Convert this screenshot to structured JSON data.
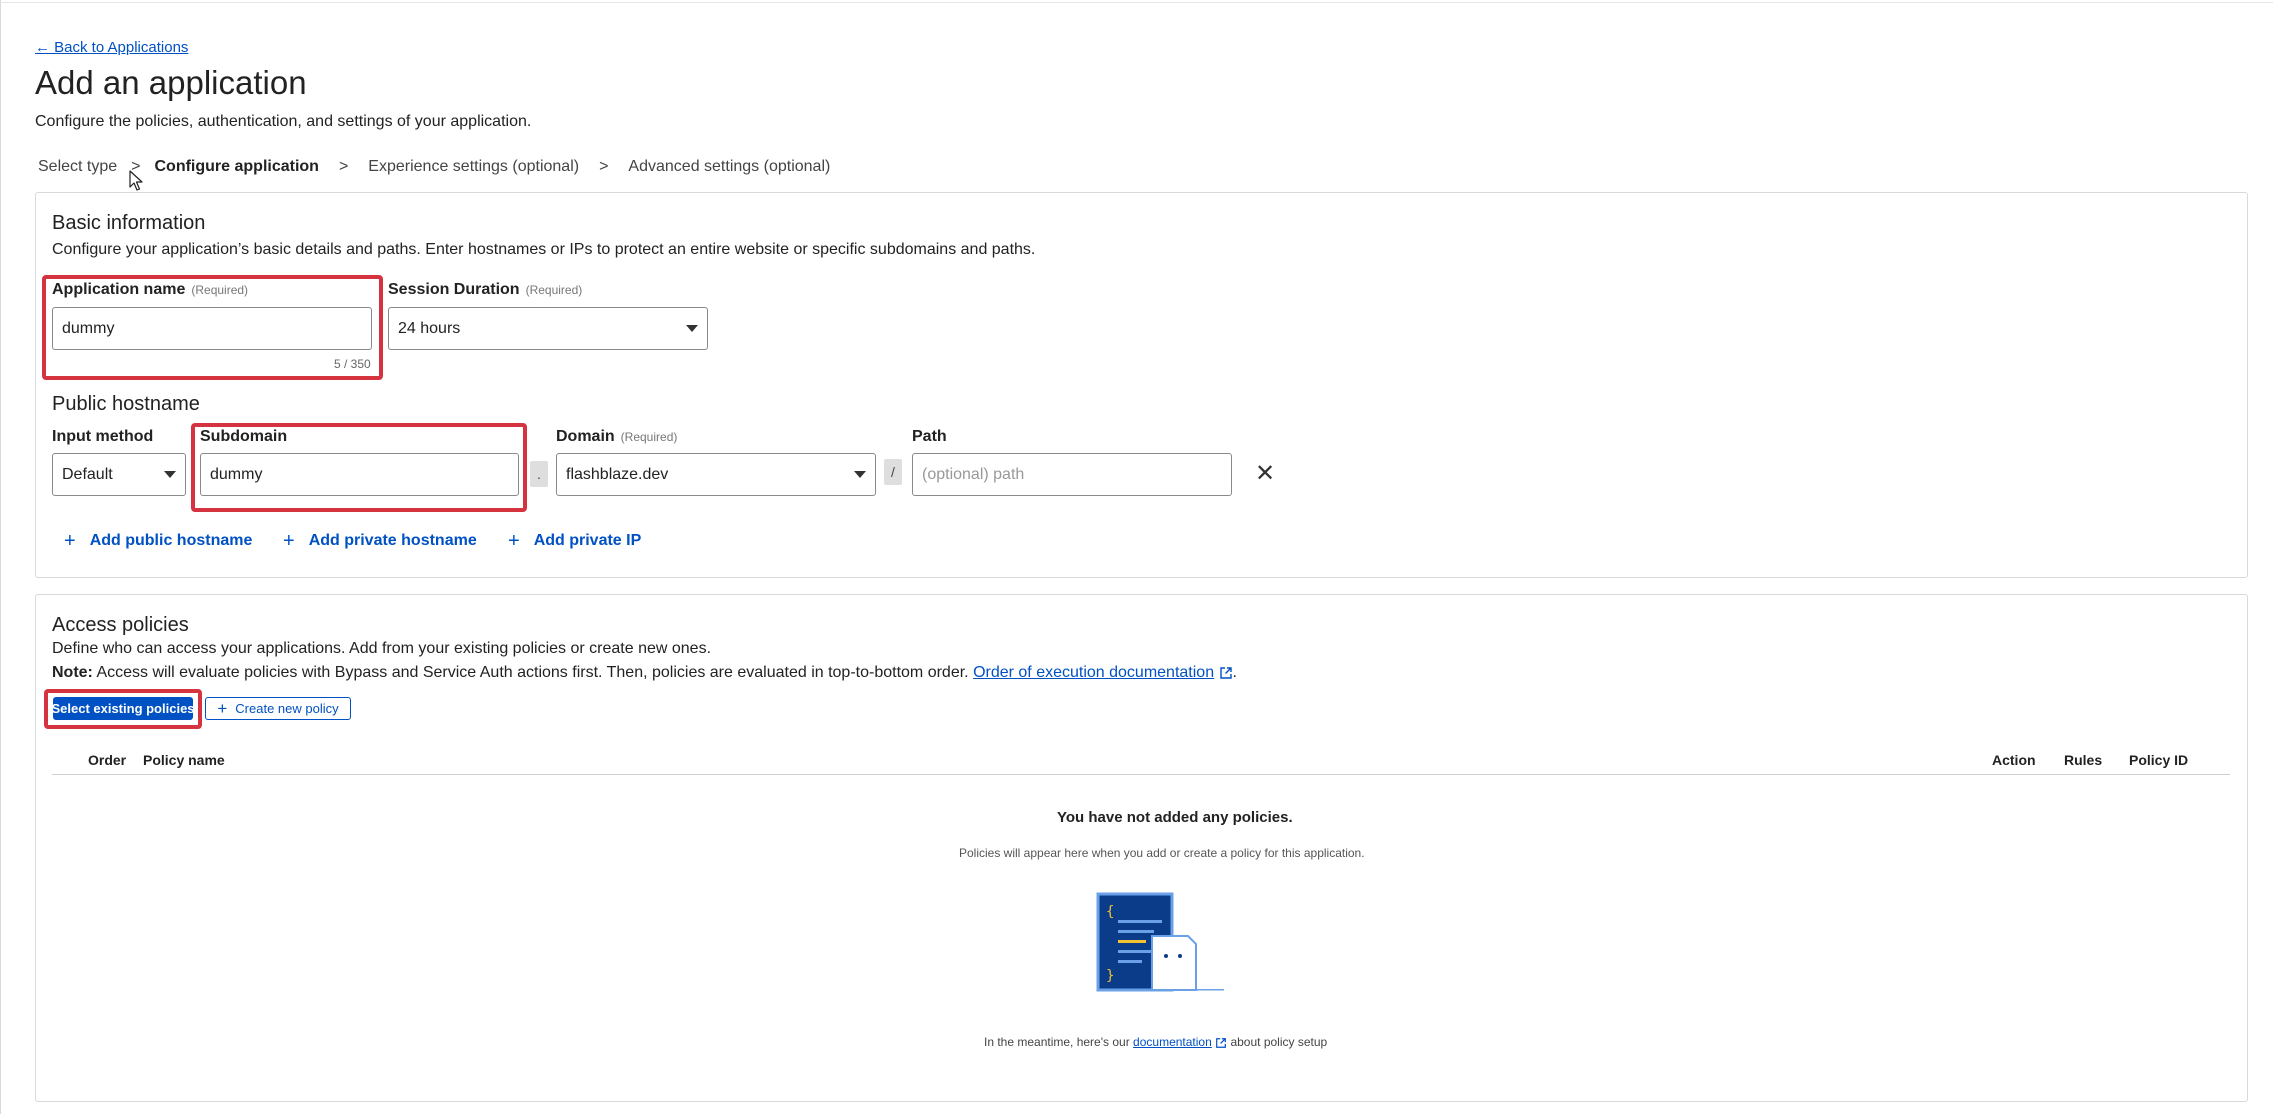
{
  "nav": {
    "back_label": "← Back to Applications"
  },
  "page": {
    "title": "Add an application",
    "subtitle": "Configure the policies, authentication, and settings of your application."
  },
  "steps": [
    {
      "label": "Select type"
    },
    {
      "label": "Configure application"
    },
    {
      "label": "Experience settings (optional)"
    },
    {
      "label": "Advanced settings (optional)"
    }
  ],
  "steps_separator": ">",
  "basic": {
    "title": "Basic information",
    "description": "Configure your application’s basic details and paths. Enter hostnames or IPs to protect an entire website or specific subdomains and paths.",
    "app_name": {
      "label": "Application name",
      "required": "(Required)",
      "value": "dummy",
      "counter": "5 / 350"
    },
    "session": {
      "label": "Session Duration",
      "required": "(Required)",
      "value": "24 hours"
    }
  },
  "hostname": {
    "title": "Public hostname",
    "input_method": {
      "label": "Input method",
      "value": "Default"
    },
    "subdomain": {
      "label": "Subdomain",
      "value": "dummy"
    },
    "dot": ".",
    "domain": {
      "label": "Domain",
      "required": "(Required)",
      "value": "flashblaze.dev"
    },
    "slash": "/",
    "path": {
      "label": "Path",
      "placeholder": "(optional) path"
    },
    "remove": "✕",
    "add_public": "Add public hostname",
    "add_private_host": "Add private hostname",
    "add_private_ip": "Add private IP"
  },
  "access": {
    "title": "Access policies",
    "description": "Define who can access your applications. Add from your existing policies or create new ones.",
    "note_label": "Note:",
    "note_text": " Access will evaluate policies with Bypass and Service Auth actions first. Then, policies are evaluated in top-to-bottom order.",
    "note_link": "Order of execution documentation",
    "note_end": ".",
    "select_existing": "Select existing policies",
    "create_new": "Create new policy",
    "columns": {
      "order": "Order",
      "policy_name": "Policy name",
      "action": "Action",
      "rules": "Rules",
      "policy_id": "Policy ID"
    },
    "empty_title": "You have not added any policies.",
    "empty_desc": "Policies will appear here when you add or create a policy for this application.",
    "doc_prefix": "In the meantime, here's our ",
    "doc_link": "documentation",
    "doc_suffix": " about policy setup"
  },
  "colors": {
    "accent": "#0051c3",
    "highlight": "#d63340",
    "illustration": "#0a3c8a"
  }
}
